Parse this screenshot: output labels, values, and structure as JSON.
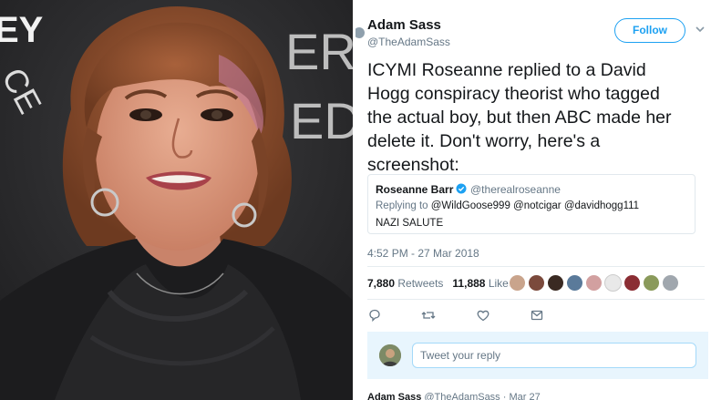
{
  "tweet": {
    "author_name": "Adam Sass",
    "author_handle": "@TheAdamSass",
    "follow_label": "Follow",
    "text": "ICYMI Roseanne replied to a David Hogg conspiracy theorist who tagged the actual boy, but then ABC made her delete it. Don't worry, here's a screenshot:",
    "quoted": {
      "name": "Roseanne Barr",
      "handle": "@therealroseanne",
      "reply_label": "Replying to",
      "reply_to": "@WildGoose999 @notcigar @davidhogg111",
      "text": "NAZI SALUTE"
    },
    "timestamp": "4:52 PM - 27 Mar 2018",
    "retweets_count": "7,880",
    "retweets_label": "Retweets",
    "likes_count": "11,888",
    "likes_label": "Likes",
    "reply_placeholder": "Tweet your reply"
  },
  "next_tweet": {
    "author_name": "Adam Sass",
    "author_handle": "@TheAdamSass",
    "date": "· Mar 27"
  },
  "backdrop_text": {
    "left_top": "EY",
    "left_bottom": "CE",
    "right_top": "ER",
    "right_bottom": "ED"
  },
  "icons": [
    "reply-icon",
    "retweet-icon",
    "like-icon",
    "dm-icon",
    "verified-icon",
    "chevron-down-icon"
  ],
  "colors": {
    "accent": "#1da1f2",
    "text": "#14171a",
    "secondary": "#657786",
    "reply_bg": "#e8f5fd"
  }
}
